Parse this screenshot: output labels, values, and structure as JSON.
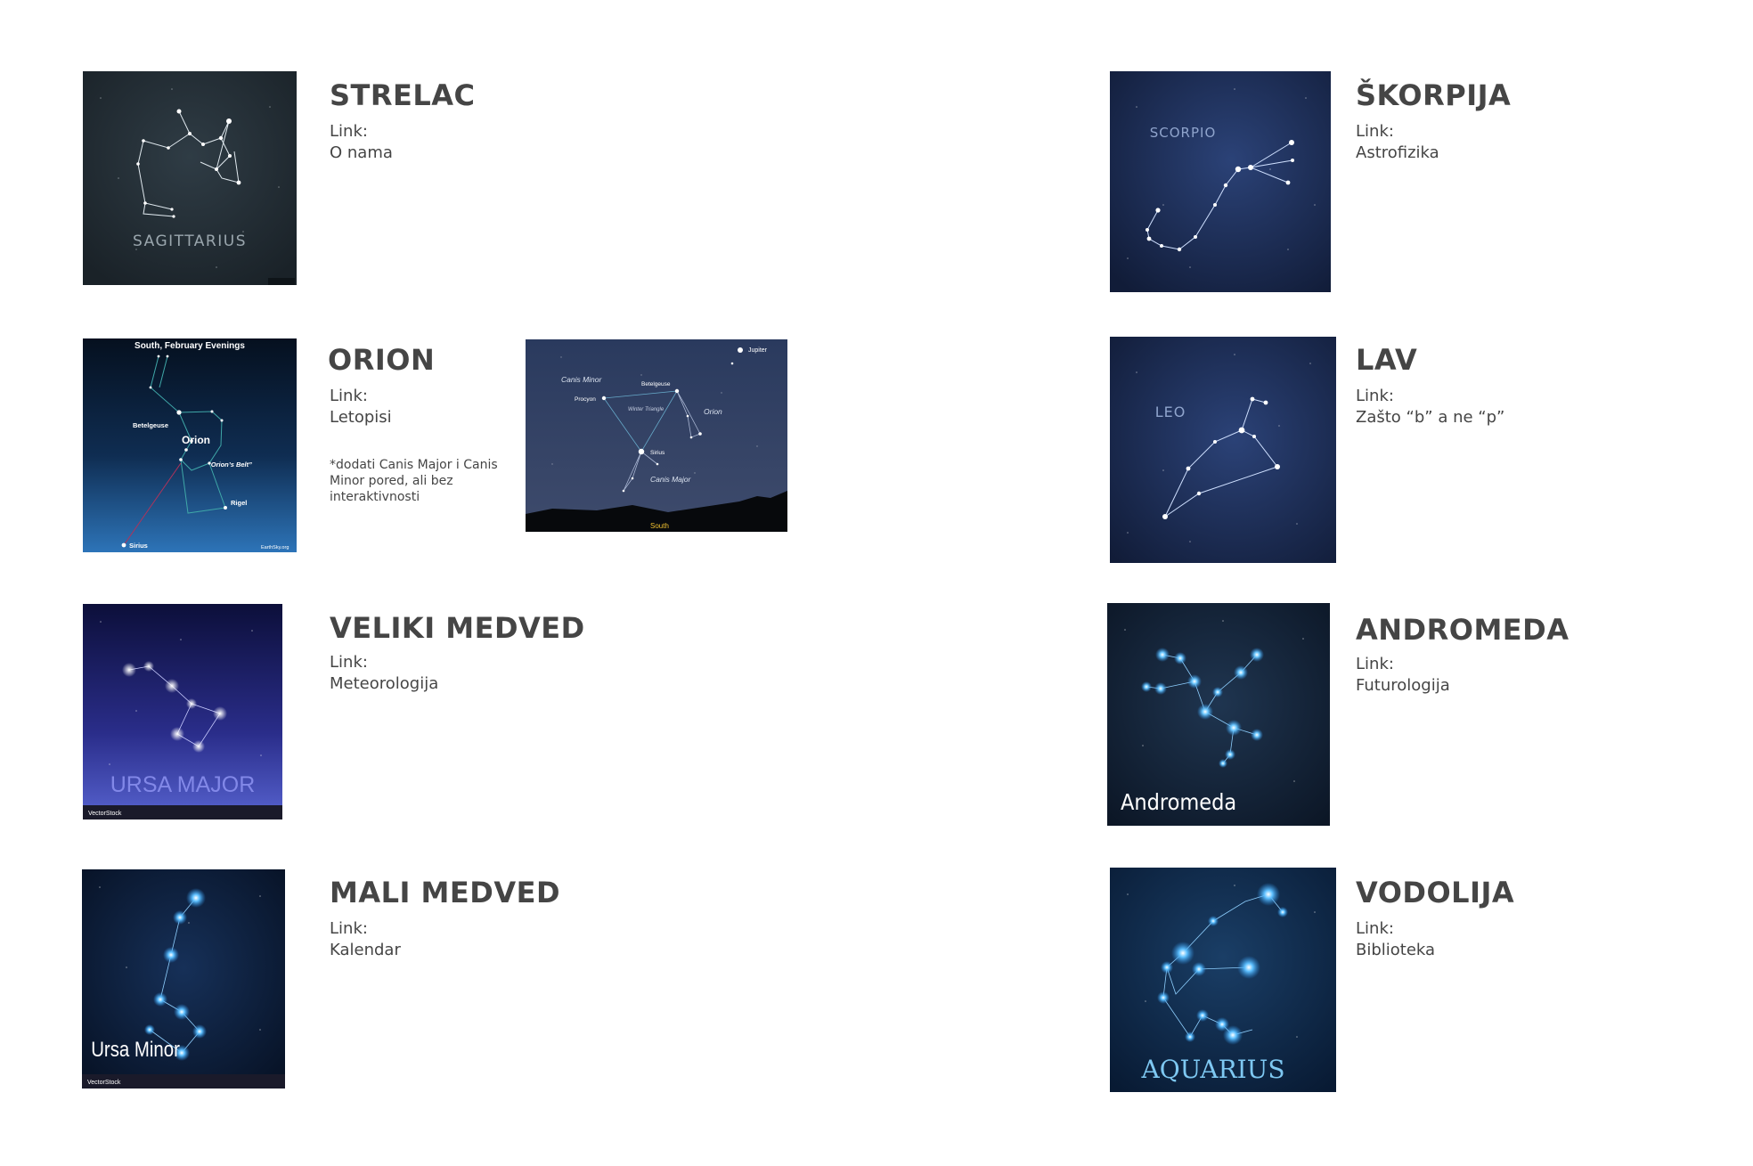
{
  "link_label": "Link:",
  "cards": {
    "strelac": {
      "title": "STRELAC",
      "link": "O nama",
      "image_text": "SAGITTARIUS"
    },
    "skorpija": {
      "title": "ŠKORPIJA",
      "link": "Astrofizika",
      "image_text": "SCORPIO"
    },
    "orion": {
      "title": "ORION",
      "link": "Letopisi",
      "note": "*dodati Canis Major i Canis Minor pored, ali bez interaktivnosti",
      "image_text": {
        "header": "South, February Evenings",
        "betelgeuse": "Betelgeuse",
        "orion": "Orion",
        "belt": "“Orion’s Belt”",
        "rigel": "Rigel",
        "sirius": "Sirius",
        "credit": "EarthSky.org"
      }
    },
    "canis": {
      "image_text": {
        "jupiter": "Jupiter",
        "canis_minor": "Canis Minor",
        "procyon": "Procyon",
        "betelgeuse": "Betelgeuse",
        "winter_triangle": "Winter Triangle",
        "orion": "Orion",
        "sirius": "Sirius",
        "canis_major": "Canis Major",
        "south": "South"
      }
    },
    "lav": {
      "title": "LAV",
      "link": "Zašto “b” a ne “p”",
      "image_text": "LEO"
    },
    "veliki": {
      "title": "VELIKI MEDVED",
      "link": "Meteorologija",
      "image_text": "URSA MAJOR",
      "credit": "VectorStock"
    },
    "andromeda": {
      "title": "ANDROMEDA",
      "link": "Futurologija",
      "image_text": "Andromeda"
    },
    "mali": {
      "title": "MALI MEDVED",
      "link": "Kalendar",
      "image_text": "Ursa Minor",
      "credit": "VectorStock"
    },
    "vodolija": {
      "title": "VODOLIJA",
      "link": "Biblioteka",
      "image_text": "AQUARIUS"
    }
  },
  "colors": {
    "text": "#454545",
    "night_dark": "#1b2a36",
    "night_blue": "#1d2f5c",
    "star_glow": "#3ab0ff"
  }
}
